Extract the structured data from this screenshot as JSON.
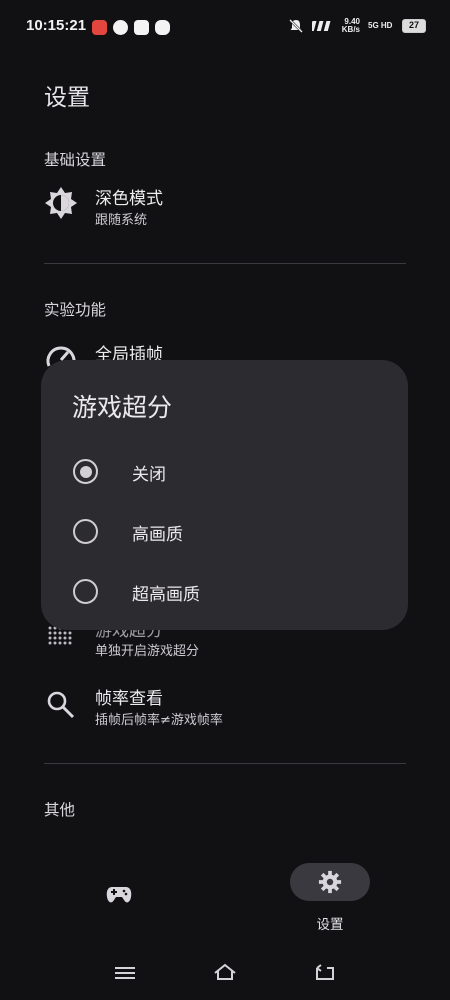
{
  "status_bar": {
    "time": "10:15:21",
    "net_speed": "9.40",
    "net_unit": "KB/s",
    "net_type": "5G HD",
    "battery": "27"
  },
  "page": {
    "title": "设置"
  },
  "sections": {
    "basic": {
      "header": "基础设置",
      "dark_mode": {
        "title": "深色模式",
        "subtitle": "跟随系统",
        "icon": "brightness-icon"
      }
    },
    "experimental": {
      "header": "实验功能",
      "global_frame": {
        "title": "全局插帧",
        "icon": "speed-icon"
      },
      "game_sr": {
        "title": "游戏超分",
        "subtitle": "单独开启游戏超分",
        "icon": "dots-icon"
      },
      "fps_view": {
        "title": "帧率查看",
        "subtitle": "插帧后帧率≠游戏帧率",
        "icon": "search-icon"
      }
    },
    "other": {
      "header": "其他"
    }
  },
  "dialog": {
    "title": "游戏超分",
    "options": [
      {
        "label": "关闭",
        "checked": true
      },
      {
        "label": "高画质",
        "checked": false
      },
      {
        "label": "超高画质",
        "checked": false
      }
    ]
  },
  "bottom_nav": {
    "items": [
      {
        "icon": "gamepad-icon",
        "label": ""
      },
      {
        "icon": "gear-icon",
        "label": "设置",
        "selected": true
      }
    ]
  }
}
